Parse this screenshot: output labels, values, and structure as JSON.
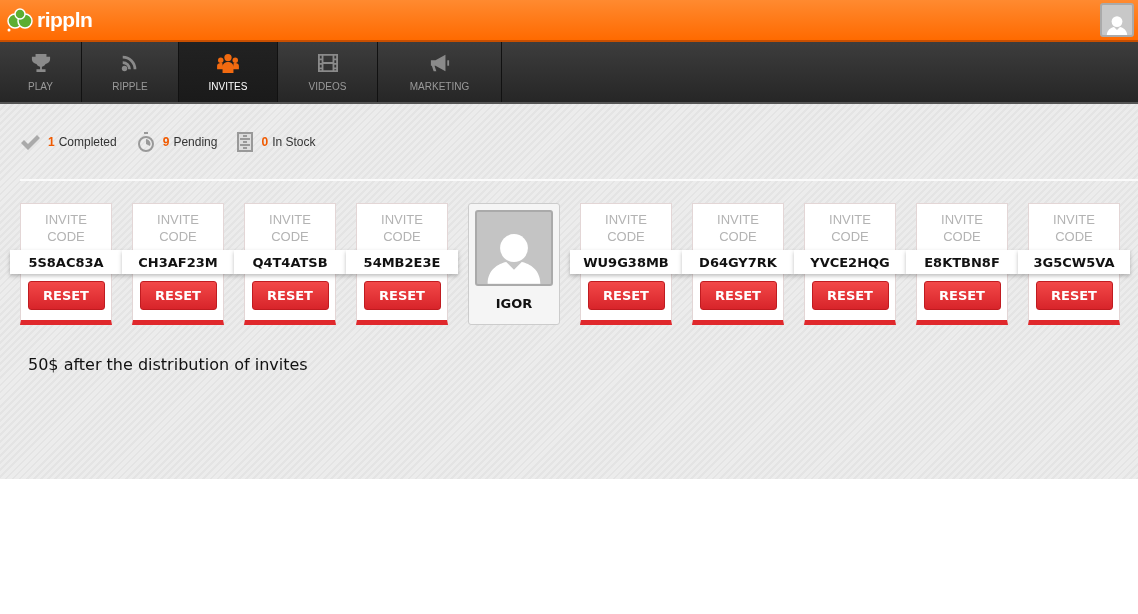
{
  "header": {
    "logo": "rippln"
  },
  "tabs": [
    {
      "label": "PLAY",
      "kind": "trophy",
      "selected": false
    },
    {
      "label": "RIPPLE",
      "kind": "feed",
      "selected": false
    },
    {
      "label": "INVITES",
      "kind": "people",
      "selected": true
    },
    {
      "label": "VIDEOS",
      "kind": "film",
      "selected": false
    },
    {
      "label": "MARKETING",
      "kind": "megaphone",
      "selected": false
    }
  ],
  "stats": [
    {
      "kind": "check",
      "count": "1",
      "label": "Completed"
    },
    {
      "kind": "timer",
      "count": "9",
      "label": "Pending"
    },
    {
      "kind": "cabinet",
      "count": "0",
      "label": "In Stock"
    }
  ],
  "cards": [
    {
      "kind": "invite",
      "title": "INVITE CODE",
      "code": "5S8AC83A",
      "button": "RESET"
    },
    {
      "kind": "invite",
      "title": "INVITE CODE",
      "code": "CH3AF23M",
      "button": "RESET"
    },
    {
      "kind": "invite",
      "title": "INVITE CODE",
      "code": "Q4T4ATSB",
      "button": "RESET"
    },
    {
      "kind": "invite",
      "title": "INVITE CODE",
      "code": "54MB2E3E",
      "button": "RESET"
    },
    {
      "kind": "profile",
      "name": "IGOR"
    },
    {
      "kind": "invite",
      "title": "INVITE CODE",
      "code": "WU9G38MB",
      "button": "RESET"
    },
    {
      "kind": "invite",
      "title": "INVITE CODE",
      "code": "D64GY7RK",
      "button": "RESET"
    },
    {
      "kind": "invite",
      "title": "INVITE CODE",
      "code": "YVCE2HQG",
      "button": "RESET"
    },
    {
      "kind": "invite",
      "title": "INVITE CODE",
      "code": "E8KTBN8F",
      "button": "RESET"
    },
    {
      "kind": "invite",
      "title": "INVITE CODE",
      "code": "3G5CW5VA",
      "button": "RESET"
    }
  ],
  "note": "50$ after the distribution of invites"
}
